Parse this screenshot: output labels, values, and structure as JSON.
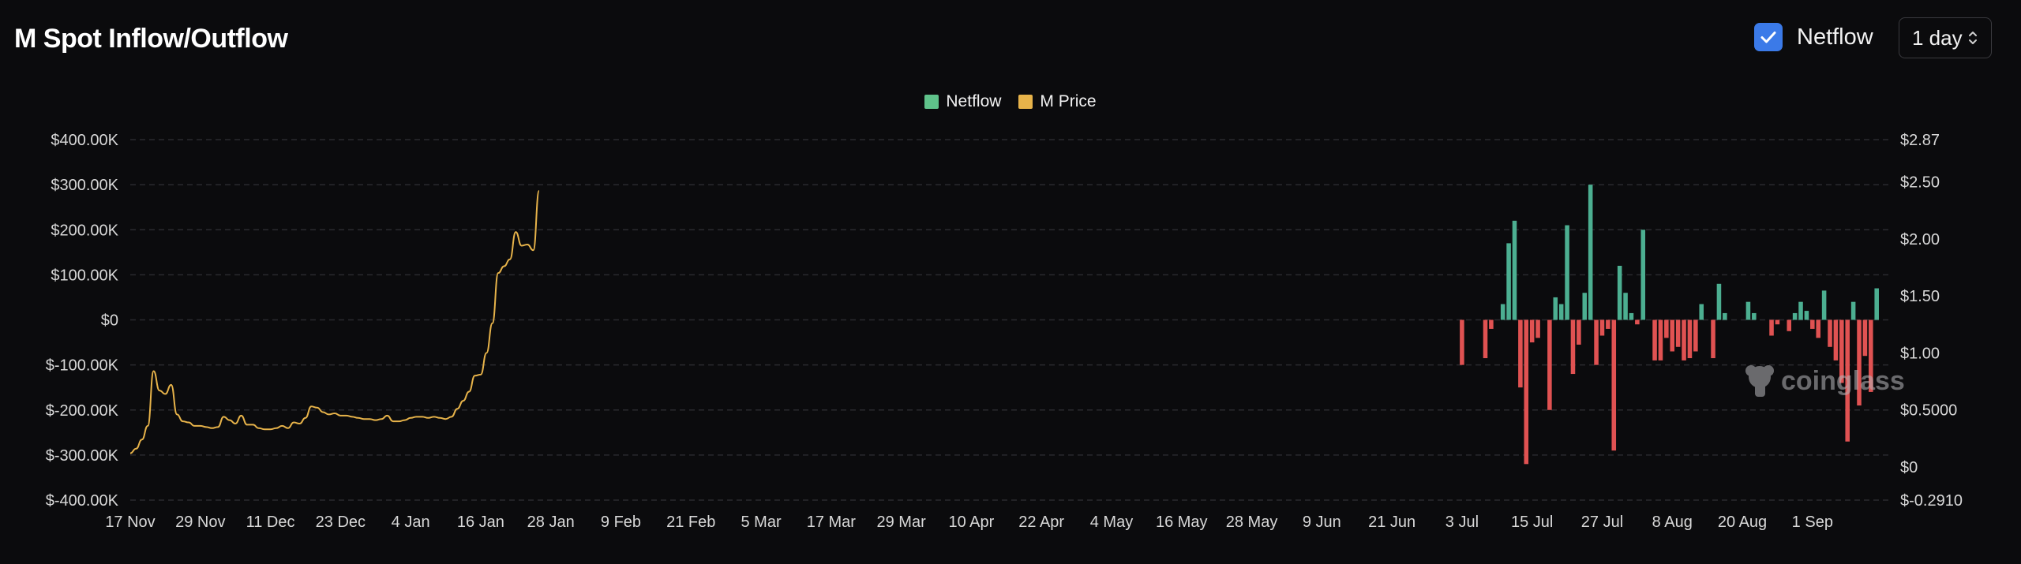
{
  "header": {
    "title": "M Spot Inflow/Outflow"
  },
  "controls": {
    "netflow_toggle_label": "Netflow",
    "netflow_checked": true,
    "interval_value": "1 day"
  },
  "legend": [
    {
      "label": "Netflow",
      "color": "#5fc28a"
    },
    {
      "label": "M Price",
      "color": "#e7b34a"
    }
  ],
  "watermark": "coinglass",
  "colors": {
    "positive": "#4caf91",
    "negative": "#e05252",
    "price": "#e7b34a",
    "grid": "#2b2b2f"
  },
  "chart_data": {
    "type": "bar",
    "y_left": {
      "min": -400000,
      "max": 400000,
      "ticks": [
        400000,
        300000,
        200000,
        100000,
        0,
        -100000,
        -200000,
        -300000,
        -400000
      ],
      "tick_labels": [
        "$400.00K",
        "$300.00K",
        "$200.00K",
        "$100.00K",
        "$0",
        "$-100.00K",
        "$-200.00K",
        "$-300.00K",
        "$-400.00K"
      ]
    },
    "y_right": {
      "min": -0.291,
      "max": 2.87,
      "ticks": [
        2.87,
        2.5,
        2.0,
        1.5,
        1.0,
        0.5,
        0,
        -0.291
      ],
      "tick_labels": [
        "$2.87",
        "$2.50",
        "$2.00",
        "$1.50",
        "$1.00",
        "$0.5000",
        "$0",
        "$-0.2910"
      ]
    },
    "x_axis": {
      "start": "2025-11-17",
      "end": "2026-09-14",
      "tick_dates": [
        "2025-11-17",
        "2025-11-29",
        "2025-12-11",
        "2025-12-23",
        "2026-01-04",
        "2026-01-16",
        "2026-01-28",
        "2026-02-09",
        "2026-02-21",
        "2026-03-05",
        "2026-03-17",
        "2026-03-29",
        "2026-04-10",
        "2026-04-22",
        "2026-05-04",
        "2026-05-16",
        "2026-05-28",
        "2026-06-09",
        "2026-06-21",
        "2026-07-03",
        "2026-07-15",
        "2026-07-27",
        "2026-08-08",
        "2026-08-20",
        "2026-09-01"
      ],
      "tick_labels": [
        "17 Nov",
        "29 Nov",
        "11 Dec",
        "23 Dec",
        "4 Jan",
        "16 Jan",
        "28 Jan",
        "9 Feb",
        "21 Feb",
        "5 Mar",
        "17 Mar",
        "29 Mar",
        "10 Apr",
        "22 Apr",
        "4 May",
        "16 May",
        "28 May",
        "9 Jun",
        "21 Jun",
        "3 Jul",
        "15 Jul",
        "27 Jul",
        "8 Aug",
        "20 Aug",
        "1 Sep"
      ]
    },
    "series": [
      {
        "name": "M Price",
        "axis": "right",
        "type": "line",
        "points": [
          [
            "2025-11-17",
            0.12
          ],
          [
            "2025-11-18",
            0.16
          ],
          [
            "2025-11-19",
            0.24
          ],
          [
            "2025-11-20",
            0.36
          ],
          [
            "2025-11-21",
            0.84
          ],
          [
            "2025-11-22",
            0.67
          ],
          [
            "2025-11-23",
            0.64
          ],
          [
            "2025-11-24",
            0.72
          ],
          [
            "2025-11-25",
            0.46
          ],
          [
            "2025-11-26",
            0.4
          ],
          [
            "2025-11-27",
            0.39
          ],
          [
            "2025-11-28",
            0.36
          ],
          [
            "2025-11-29",
            0.36
          ],
          [
            "2025-11-30",
            0.35
          ],
          [
            "2025-12-01",
            0.34
          ],
          [
            "2025-12-02",
            0.35
          ],
          [
            "2025-12-03",
            0.44
          ],
          [
            "2025-12-04",
            0.41
          ],
          [
            "2025-12-05",
            0.38
          ],
          [
            "2025-12-06",
            0.45
          ],
          [
            "2025-12-07",
            0.37
          ],
          [
            "2025-12-08",
            0.37
          ],
          [
            "2025-12-09",
            0.34
          ],
          [
            "2025-12-10",
            0.33
          ],
          [
            "2025-12-11",
            0.33
          ],
          [
            "2025-12-12",
            0.34
          ],
          [
            "2025-12-13",
            0.36
          ],
          [
            "2025-12-14",
            0.34
          ],
          [
            "2025-12-15",
            0.39
          ],
          [
            "2025-12-16",
            0.38
          ],
          [
            "2025-12-17",
            0.43
          ],
          [
            "2025-12-18",
            0.53
          ],
          [
            "2025-12-19",
            0.52
          ],
          [
            "2025-12-20",
            0.48
          ],
          [
            "2025-12-21",
            0.46
          ],
          [
            "2025-12-22",
            0.47
          ],
          [
            "2025-12-23",
            0.45
          ],
          [
            "2025-12-24",
            0.45
          ],
          [
            "2025-12-25",
            0.44
          ],
          [
            "2025-12-26",
            0.43
          ],
          [
            "2025-12-27",
            0.42
          ],
          [
            "2025-12-28",
            0.42
          ],
          [
            "2025-12-29",
            0.41
          ],
          [
            "2025-12-30",
            0.42
          ],
          [
            "2025-12-31",
            0.45
          ],
          [
            "2026-01-01",
            0.4
          ],
          [
            "2026-01-02",
            0.4
          ],
          [
            "2026-01-03",
            0.41
          ],
          [
            "2026-01-04",
            0.43
          ],
          [
            "2026-01-05",
            0.44
          ],
          [
            "2026-01-06",
            0.44
          ],
          [
            "2026-01-07",
            0.43
          ],
          [
            "2026-01-08",
            0.44
          ],
          [
            "2026-01-09",
            0.43
          ],
          [
            "2026-01-10",
            0.42
          ],
          [
            "2026-01-11",
            0.44
          ],
          [
            "2026-01-12",
            0.51
          ],
          [
            "2026-01-13",
            0.58
          ],
          [
            "2026-01-14",
            0.66
          ],
          [
            "2026-01-15",
            0.8
          ],
          [
            "2026-01-16",
            0.81
          ],
          [
            "2026-01-17",
            1.0
          ],
          [
            "2026-01-18",
            1.26
          ],
          [
            "2026-01-19",
            1.7
          ],
          [
            "2026-01-20",
            1.76
          ],
          [
            "2026-01-21",
            1.82
          ],
          [
            "2026-01-22",
            2.06
          ],
          [
            "2026-01-23",
            1.94
          ],
          [
            "2026-01-24",
            1.95
          ],
          [
            "2026-01-25",
            1.9
          ],
          [
            "2026-01-26",
            2.42
          ]
        ]
      },
      {
        "name": "Netflow",
        "axis": "left",
        "type": "bar",
        "points": [
          [
            "2026-07-03",
            -100000
          ],
          [
            "2026-07-07",
            -85000
          ],
          [
            "2026-07-08",
            -20000
          ],
          [
            "2026-07-10",
            35000
          ],
          [
            "2026-07-11",
            170000
          ],
          [
            "2026-07-12",
            220000
          ],
          [
            "2026-07-13",
            -150000
          ],
          [
            "2026-07-14",
            -320000
          ],
          [
            "2026-07-15",
            -50000
          ],
          [
            "2026-07-16",
            -40000
          ],
          [
            "2026-07-18",
            -200000
          ],
          [
            "2026-07-19",
            50000
          ],
          [
            "2026-07-20",
            35000
          ],
          [
            "2026-07-21",
            210000
          ],
          [
            "2026-07-22",
            -120000
          ],
          [
            "2026-07-23",
            -55000
          ],
          [
            "2026-07-24",
            60000
          ],
          [
            "2026-07-25",
            300000
          ],
          [
            "2026-07-26",
            -100000
          ],
          [
            "2026-07-27",
            -35000
          ],
          [
            "2026-07-28",
            -20000
          ],
          [
            "2026-07-29",
            -290000
          ],
          [
            "2026-07-30",
            120000
          ],
          [
            "2026-07-31",
            60000
          ],
          [
            "2026-08-01",
            15000
          ],
          [
            "2026-08-02",
            -10000
          ],
          [
            "2026-08-03",
            200000
          ],
          [
            "2026-08-05",
            -90000
          ],
          [
            "2026-08-06",
            -90000
          ],
          [
            "2026-08-07",
            -40000
          ],
          [
            "2026-08-08",
            -70000
          ],
          [
            "2026-08-09",
            -60000
          ],
          [
            "2026-08-10",
            -90000
          ],
          [
            "2026-08-11",
            -85000
          ],
          [
            "2026-08-12",
            -70000
          ],
          [
            "2026-08-13",
            35000
          ],
          [
            "2026-08-15",
            -85000
          ],
          [
            "2026-08-16",
            80000
          ],
          [
            "2026-08-17",
            15000
          ],
          [
            "2026-08-21",
            40000
          ],
          [
            "2026-08-22",
            15000
          ],
          [
            "2026-08-25",
            -35000
          ],
          [
            "2026-08-26",
            -10000
          ],
          [
            "2026-08-28",
            -25000
          ],
          [
            "2026-08-29",
            15000
          ],
          [
            "2026-08-30",
            40000
          ],
          [
            "2026-08-31",
            20000
          ],
          [
            "2026-09-01",
            -20000
          ],
          [
            "2026-09-02",
            -40000
          ],
          [
            "2026-09-03",
            65000
          ],
          [
            "2026-09-04",
            -60000
          ],
          [
            "2026-09-05",
            -90000
          ],
          [
            "2026-09-06",
            -140000
          ],
          [
            "2026-09-07",
            -270000
          ],
          [
            "2026-09-08",
            40000
          ],
          [
            "2026-09-09",
            -190000
          ],
          [
            "2026-09-10",
            -80000
          ],
          [
            "2026-09-11",
            -160000
          ],
          [
            "2026-09-12",
            70000
          ]
        ]
      }
    ]
  }
}
